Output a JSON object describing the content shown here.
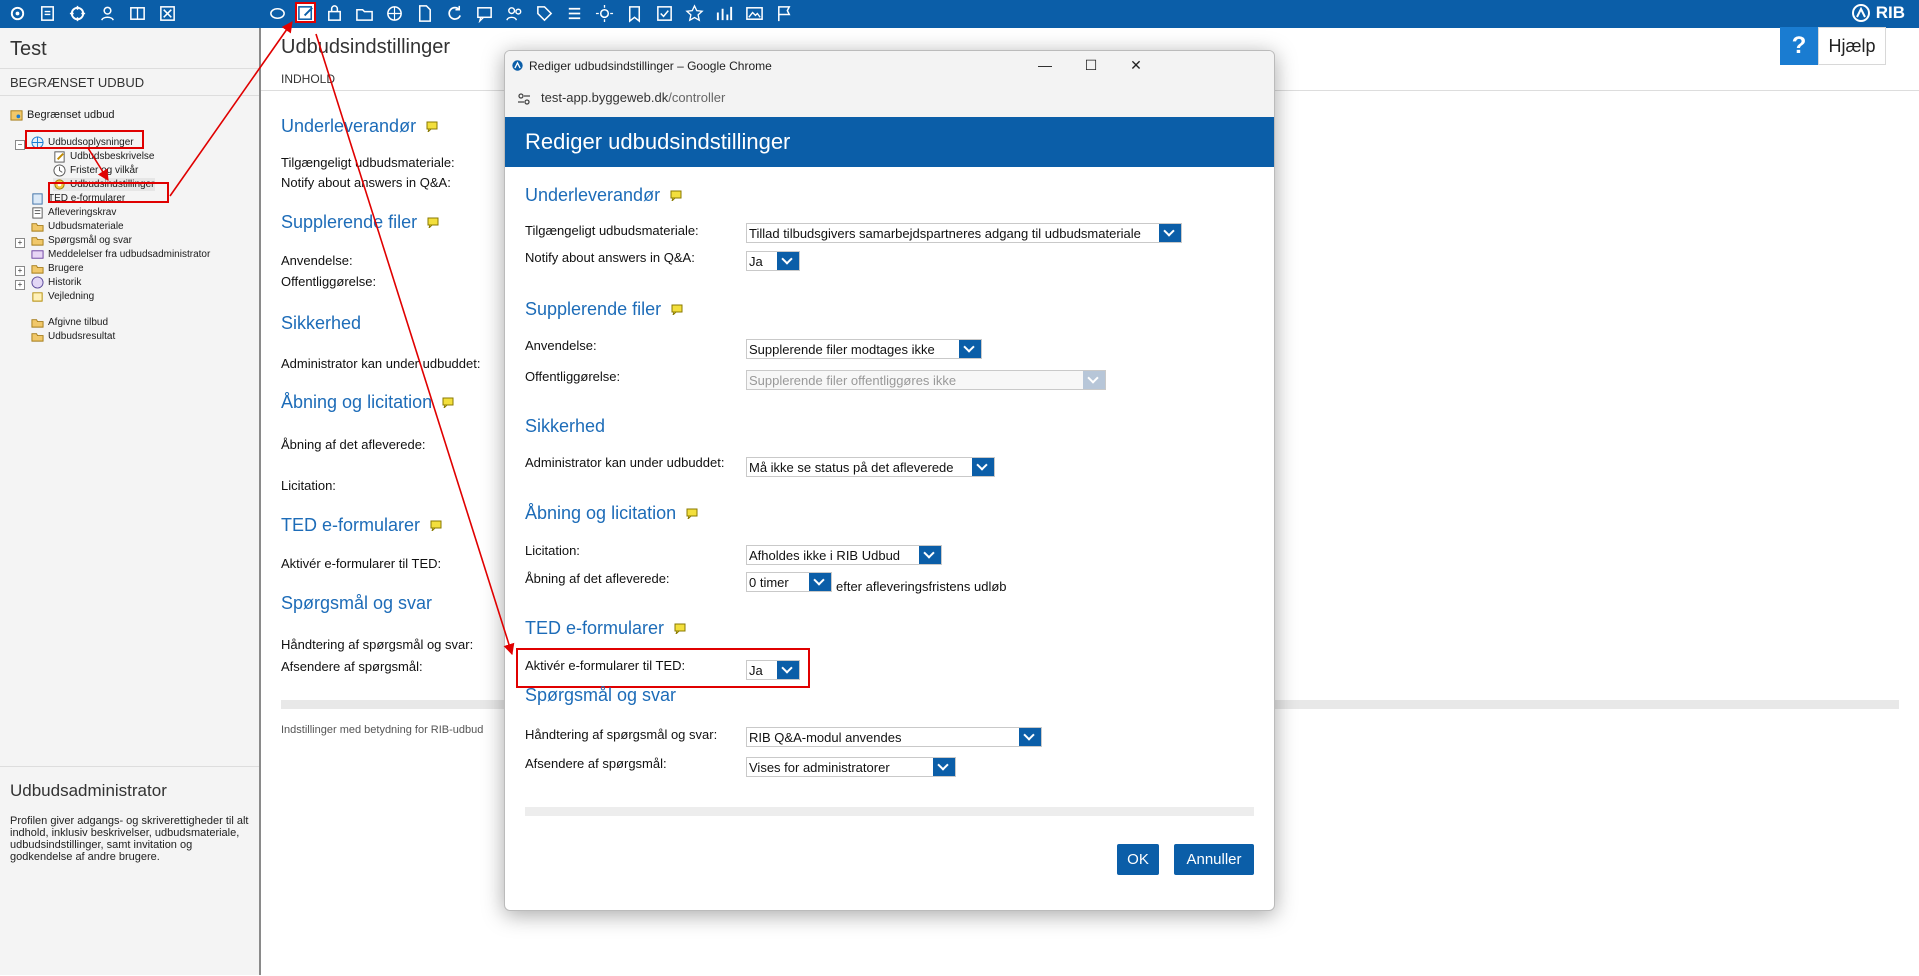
{
  "app": {
    "brand": "RIB"
  },
  "left": {
    "title": "Test",
    "subtitle": "BEGRÆNSET UDBUD",
    "tree": [
      {
        "label": "Begrænset udbud"
      },
      {
        "label": "Udbudsoplysninger"
      },
      {
        "label": "Udbudsbeskrivelse"
      },
      {
        "label": "Frister og vilkår"
      },
      {
        "label": "Udbudsindstillinger"
      },
      {
        "label": "TED e-formularer"
      },
      {
        "label": "Afleveringskrav"
      },
      {
        "label": "Udbudsmateriale"
      },
      {
        "label": "Spørgsmål og svar"
      },
      {
        "label": "Meddelelser fra udbudsadministrator"
      },
      {
        "label": "Brugere"
      },
      {
        "label": "Historik"
      },
      {
        "label": "Vejledning"
      },
      {
        "label": "Afgivne tilbud"
      },
      {
        "label": "Udbudsresultat"
      }
    ],
    "admin": {
      "title": "Udbudsadministrator",
      "description": "Profilen giver adgangs- og skriverettigheder til alt indhold, inklusiv beskrivelser, udbudsmateriale, udbudsindstillinger, samt invitation og godkendelse af andre brugere."
    }
  },
  "main": {
    "title": "Udbudsindstillinger",
    "section_label": "INDHOLD",
    "headings": [
      "Underleverandør",
      "Supplerende filer",
      "Sikkerhed",
      "Åbning og licitation",
      "TED e-formularer",
      "Spørgsmål og svar"
    ],
    "labels": [
      "Tilgængeligt udbudsmateriale:",
      "Notify about answers in Q&A:",
      "Anvendelse:",
      "Offentliggørelse:",
      "Administrator kan under udbuddet:",
      "Åbning af det afleverede:",
      "Licitation:",
      "Aktivér e-formularer til TED:",
      "Håndtering af spørgsmål og svar:",
      "Afsendere af spørgsmål:"
    ],
    "footer": "Indstillinger med betydning for RIB-udbud"
  },
  "help": {
    "icon": "?",
    "label": "Hjælp"
  },
  "dialog": {
    "window_title": "Rediger udbudsindstillinger – Google Chrome",
    "url_host": "test-app.byggeweb.dk",
    "url_path": "/controller",
    "header": "Rediger udbudsindstillinger",
    "sections": {
      "underleverandor": {
        "title": "Underleverandør",
        "material_label": "Tilgængeligt udbudsmateriale:",
        "material_value": "Tillad tilbudsgivers samarbejdspartneres adgang til udbudsmateriale",
        "notify_label": "Notify about answers in Q&A:",
        "notify_value": "Ja"
      },
      "supplerende": {
        "title": "Supplerende filer",
        "anvendelse_label": "Anvendelse:",
        "anvendelse_value": "Supplerende filer modtages ikke",
        "offentlig_label": "Offentliggørelse:",
        "offentlig_value": "Supplerende filer offentliggøres ikke"
      },
      "sikkerhed": {
        "title": "Sikkerhed",
        "admin_label": "Administrator kan under udbuddet:",
        "admin_value": "Må ikke se status på det afleverede"
      },
      "aabning": {
        "title": "Åbning og licitation",
        "licitation_label": "Licitation:",
        "licitation_value": "Afholdes ikke i RIB Udbud",
        "aabning_label": "Åbning af det afleverede:",
        "aabning_value": "0 timer",
        "aabning_suffix": "efter afleveringsfristens udløb"
      },
      "ted": {
        "title": "TED e-formularer",
        "activate_label": "Aktivér e-formularer til TED:",
        "activate_value": "Ja"
      },
      "qa": {
        "title": "Spørgsmål og svar",
        "handling_label": "Håndtering af spørgsmål og svar:",
        "handling_value": "RIB Q&A-modul anvendes",
        "senders_label": "Afsendere af spørgsmål:",
        "senders_value": "Vises for administratorer"
      }
    },
    "ok_label": "OK",
    "cancel_label": "Annuller"
  },
  "colors": {
    "brand_blue": "#0b5ea8",
    "heading_blue": "#1d6cb8",
    "annotation_red": "#e00000"
  }
}
